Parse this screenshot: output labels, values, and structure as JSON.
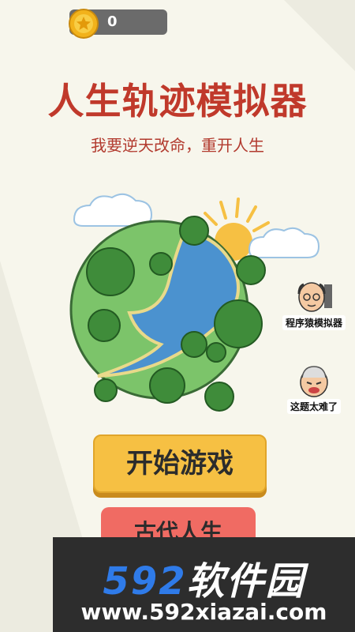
{
  "header": {
    "coin_count": "0"
  },
  "title": "人生轨迹模拟器",
  "subtitle": "我要逆天改命，重开人生",
  "side_items": [
    {
      "label": "程序猿模拟器",
      "icon": "programmer-avatar-icon"
    },
    {
      "label": "这题太难了",
      "icon": "old-man-avatar-icon"
    }
  ],
  "buttons": {
    "start": "开始游戏",
    "ancient": "古代人生"
  },
  "watermark": {
    "num": "592",
    "name": "软件园",
    "url": "www.592xiazai.com"
  },
  "colors": {
    "title": "#c0392b",
    "start_button": "#f6c043",
    "ancient_button": "#f06b63",
    "watermark_blue": "#2f7be9"
  }
}
